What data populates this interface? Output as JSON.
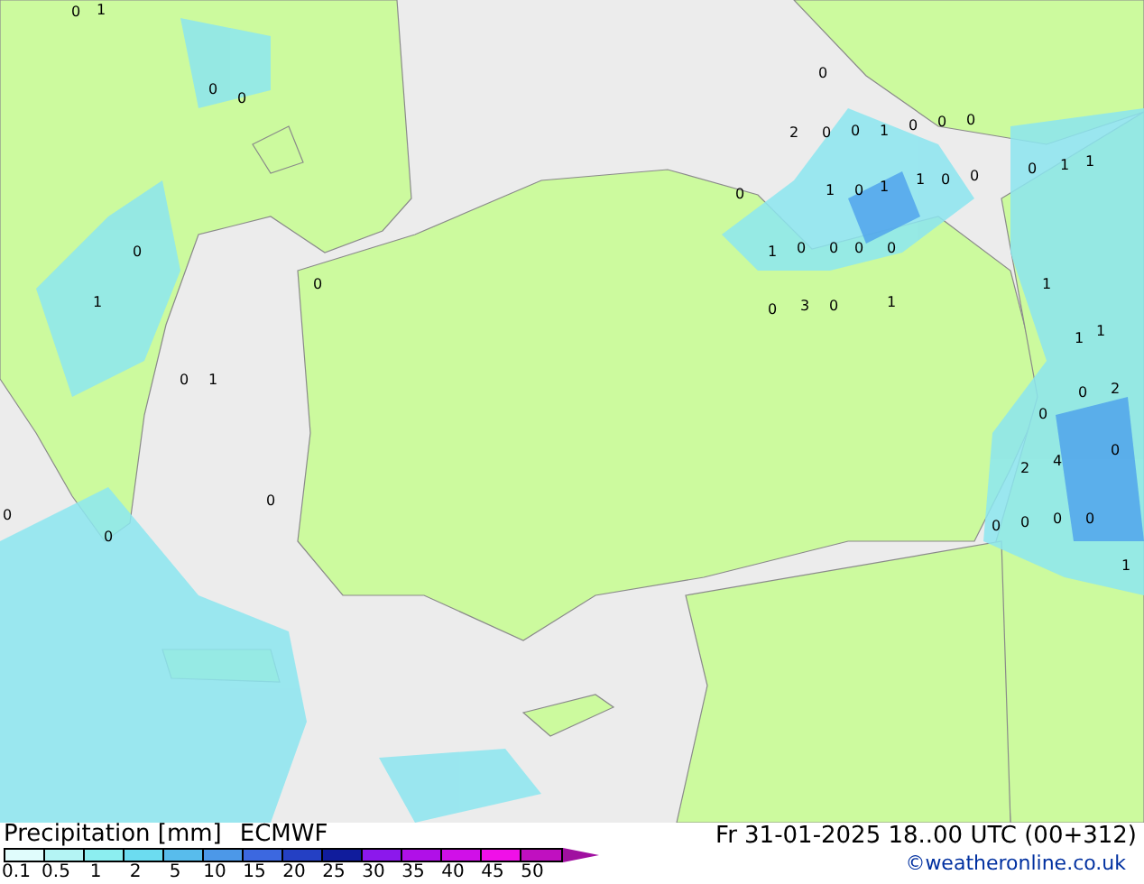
{
  "map": {
    "labels": [
      "0",
      "1",
      "0",
      "0",
      "0",
      "2",
      "0",
      "0",
      "1",
      "0",
      "0",
      "0",
      "1",
      "1",
      "0",
      "0",
      "1",
      "0",
      "1",
      "1",
      "0",
      "0",
      "0",
      "1",
      "0",
      "1",
      "0",
      "0",
      "0",
      "0",
      "1",
      "1",
      "1",
      "0",
      "3",
      "0",
      "1",
      "0",
      "2",
      "0",
      "2",
      "4",
      "0",
      "0",
      "0",
      "0",
      "0",
      "1",
      "0",
      "1",
      "0",
      "0",
      "0"
    ]
  },
  "legend": {
    "title": "Precipitation [mm]",
    "model": "ECMWF",
    "bins": [
      {
        "color": "#e0fcfc"
      },
      {
        "color": "#b4f4f4"
      },
      {
        "color": "#8ceef0"
      },
      {
        "color": "#6cdcf0"
      },
      {
        "color": "#58bcec"
      },
      {
        "color": "#4c98e8"
      },
      {
        "color": "#3c68e0"
      },
      {
        "color": "#2440c4"
      },
      {
        "color": "#101c9c"
      },
      {
        "color": "#8c18ec"
      },
      {
        "color": "#b010e8"
      },
      {
        "color": "#d010e8"
      },
      {
        "color": "#f010e8"
      },
      {
        "color": "#c010c0"
      }
    ],
    "ticks": [
      "0.1",
      "0.5",
      "1",
      "2",
      "5",
      "10",
      "15",
      "20",
      "25",
      "30",
      "35",
      "40",
      "45",
      "50"
    ]
  },
  "valid_time": "Fr 31-01-2025 18..00 UTC (00+312)",
  "credit": "©weatheronline.co.uk"
}
